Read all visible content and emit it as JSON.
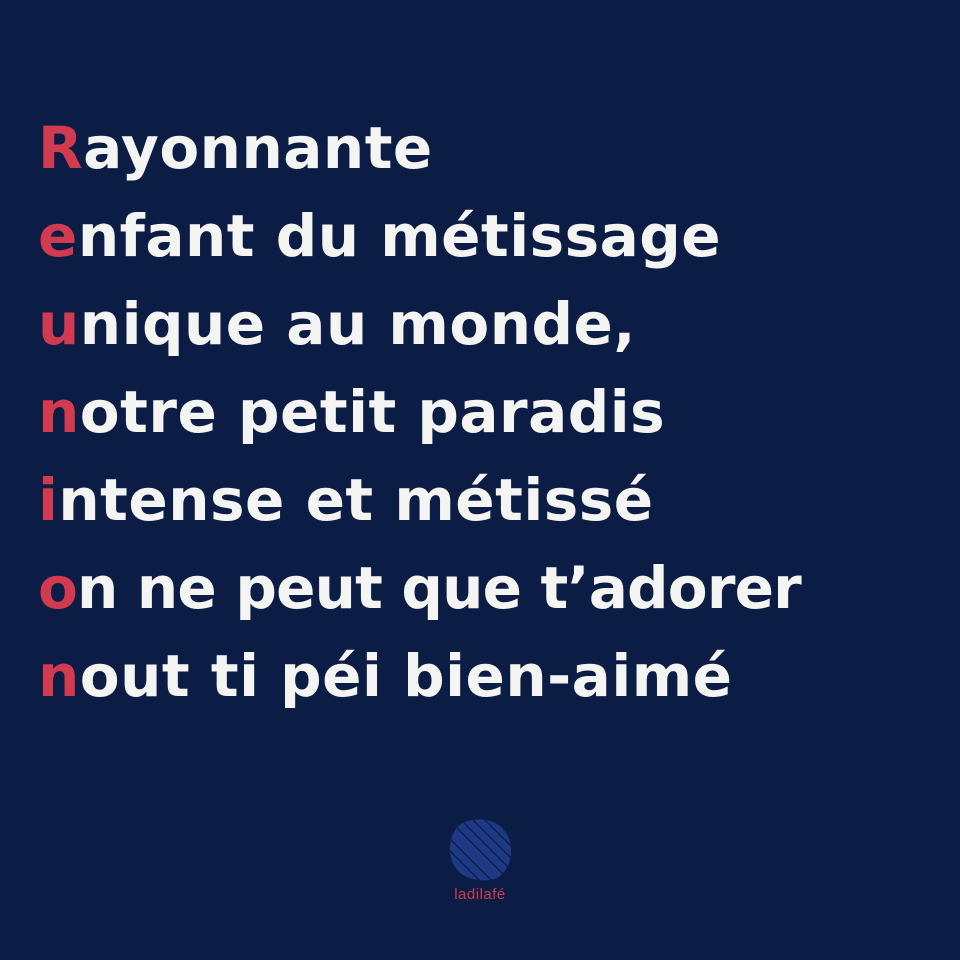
{
  "poem": {
    "lines": [
      {
        "initial": "R",
        "rest": "ayonnante"
      },
      {
        "initial": "e",
        "rest": "nfant du métissage"
      },
      {
        "initial": "u",
        "rest": "nique au monde,"
      },
      {
        "initial": "n",
        "rest": "otre petit paradis"
      },
      {
        "initial": "i",
        "rest": "ntense et métissé"
      },
      {
        "initial": "o",
        "rest": "n ne peut que t’adorer"
      },
      {
        "initial": "n",
        "rest": "out ti péi bien-aimé"
      }
    ]
  },
  "brand": {
    "name": "ladilafé",
    "logo_icon": "reunion-island-map-icon"
  },
  "colors": {
    "background": "#0c1d45",
    "initial_letter": "#d13a4f",
    "text": "#f4f4f2",
    "logo_island": "#1e3a86"
  }
}
